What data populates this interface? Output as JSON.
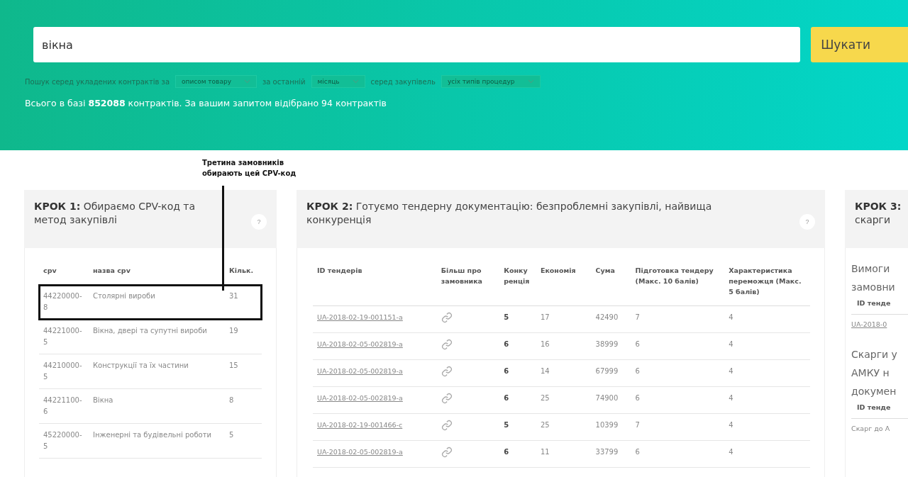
{
  "search": {
    "value": "вікна",
    "button": "Шукати"
  },
  "filters": [
    {
      "kind": "text",
      "label": "Пошук серед укладених контрактів за"
    },
    {
      "kind": "select",
      "label": "описом товару"
    },
    {
      "kind": "text",
      "label": "за останній"
    },
    {
      "kind": "select",
      "label": "місяць"
    },
    {
      "kind": "text",
      "label": "серед закупівель"
    },
    {
      "kind": "select",
      "label": "усіх типів процедур"
    }
  ],
  "summary": "Всього в базі **852088** контрактів. За вашим запитом відібрано 94 контрактів",
  "annotation": {
    "text": "Третина замовників обирають цей CPV-код"
  },
  "step1": {
    "title": "**КРОК 1:** Обираємо CPV-код та метод закупівлі",
    "help": "?",
    "columns": [
      "cpv",
      "назва cpv",
      "Кільк."
    ],
    "rows": [
      {
        "cpv": "44220000-8",
        "name": "Столярні вироби",
        "count": "31",
        "highlighted": true
      },
      {
        "cpv": "44221000-5",
        "name": "Вікна, двері та супутні вироби",
        "count": "19",
        "highlighted": false
      },
      {
        "cpv": "44210000-5",
        "name": "Конструкції та їх частини",
        "count": "15",
        "highlighted": false
      },
      {
        "cpv": "44221100-6",
        "name": "Вікна",
        "count": "8",
        "highlighted": false
      },
      {
        "cpv": "45220000-5",
        "name": "Інженерні та будівельні роботи",
        "count": "5",
        "highlighted": false
      }
    ]
  },
  "step2": {
    "title": "**КРОК 2:** Готуємо тендерну документацію: безпроблемні закупівлі, найвища конкуренція",
    "help": "?",
    "columns": [
      "ID тендерів",
      "Більш про замовника",
      "Конкуренція",
      "Економія",
      "Сума",
      "Підготовка тендеру (Макс. 10 балів)",
      "Характеристика переможця (Макс. 5 балів)"
    ],
    "rows": [
      {
        "id": "UA-2018-02-19-001151-a",
        "competition": "5",
        "economy": "17",
        "sum": "42490",
        "preparation": "7",
        "winner": "4"
      },
      {
        "id": "UA-2018-02-05-002819-a",
        "competition": "6",
        "economy": "16",
        "sum": "38999",
        "preparation": "6",
        "winner": "4"
      },
      {
        "id": "UA-2018-02-05-002819-a",
        "competition": "6",
        "economy": "14",
        "sum": "67999",
        "preparation": "6",
        "winner": "4"
      },
      {
        "id": "UA-2018-02-05-002819-a",
        "competition": "6",
        "economy": "25",
        "sum": "74900",
        "preparation": "6",
        "winner": "4"
      },
      {
        "id": "UA-2018-02-19-001466-c",
        "competition": "5",
        "economy": "25",
        "sum": "10399",
        "preparation": "7",
        "winner": "4"
      },
      {
        "id": "UA-2018-02-05-002819-a",
        "competition": "6",
        "economy": "11",
        "sum": "33799",
        "preparation": "6",
        "winner": "4"
      }
    ]
  },
  "step3": {
    "title": [
      "**КРОК 3:**",
      "скарги"
    ],
    "sections": [
      {
        "heading": [
          "Вимоги",
          "замовни"
        ],
        "column": "ID тенде",
        "link": "UA-2018-0"
      },
      {
        "heading": [
          "Скарги у",
          "АМКУ н",
          "докумен"
        ],
        "column": "ID тенде",
        "note": "Скарг до А"
      }
    ]
  }
}
